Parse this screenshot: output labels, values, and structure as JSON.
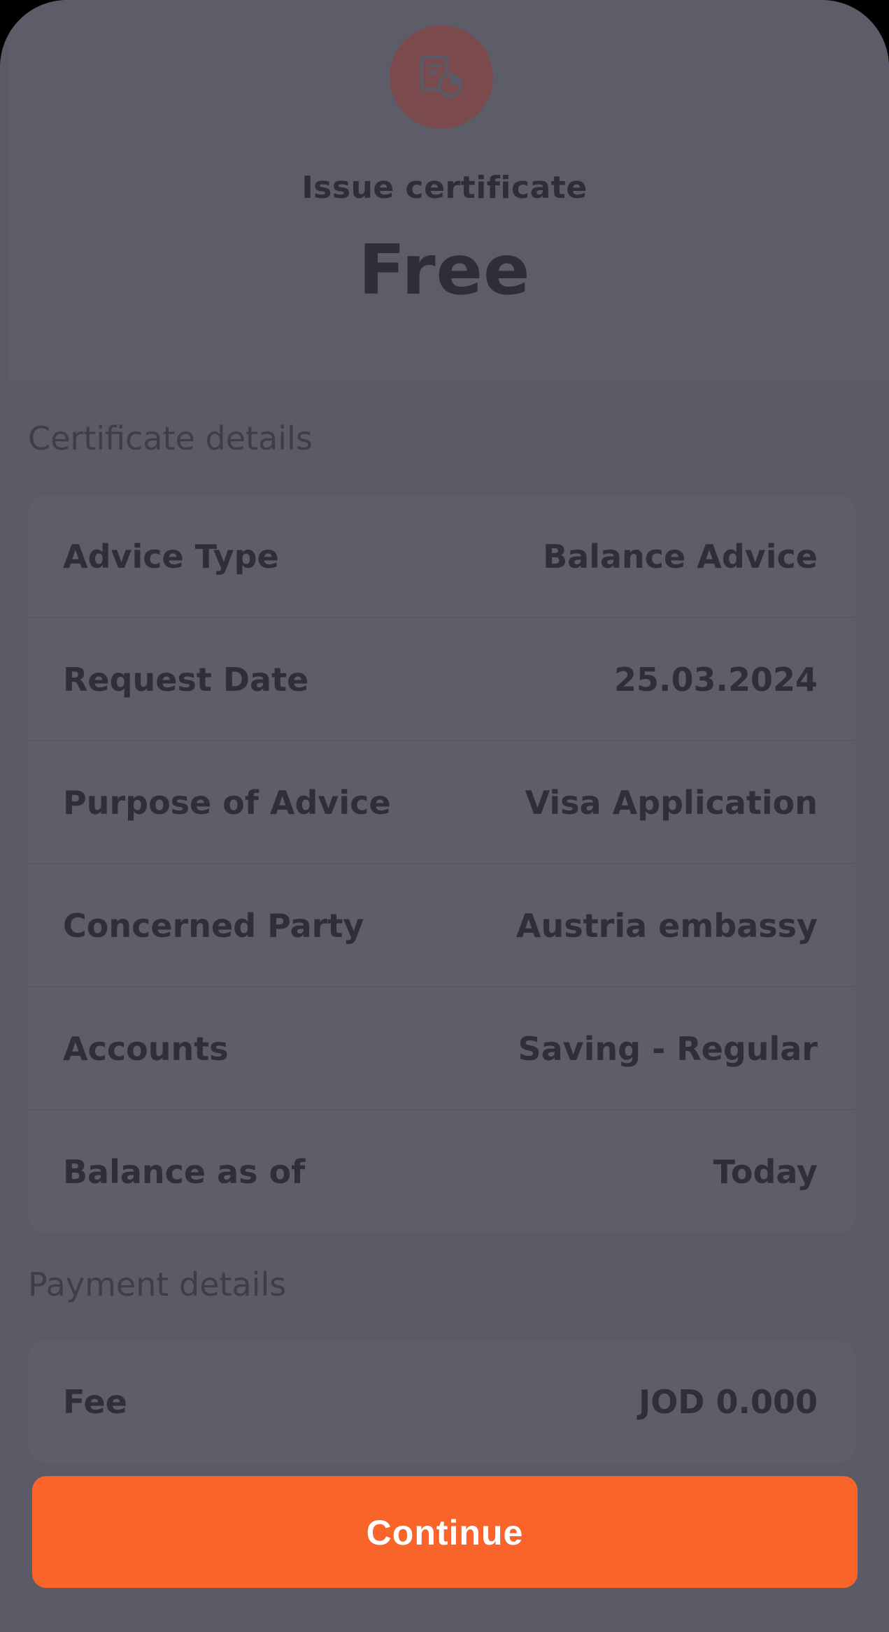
{
  "header": {
    "icon": "certificate-icon",
    "title": "Issue certificate",
    "price": "Free"
  },
  "certificate_details": {
    "section_label": "Certificate details",
    "rows": [
      {
        "label": "Advice Type",
        "value": "Balance Advice"
      },
      {
        "label": "Request Date",
        "value": "25.03.2024"
      },
      {
        "label": "Purpose of Advice",
        "value": "Visa Application"
      },
      {
        "label": "Concerned Party",
        "value": "Austria embassy"
      },
      {
        "label": "Accounts",
        "value": "Saving - Regular"
      },
      {
        "label": "Balance as of",
        "value": "Today"
      }
    ]
  },
  "payment_details": {
    "section_label": "Payment details",
    "rows": [
      {
        "label": "Fee",
        "value": "JOD 0.000"
      }
    ]
  },
  "footer": {
    "continue_label": "Continue"
  },
  "colors": {
    "accent": "#f8642a",
    "overlay": "#5b5b67",
    "icon_bg": "#7b4a4c"
  }
}
